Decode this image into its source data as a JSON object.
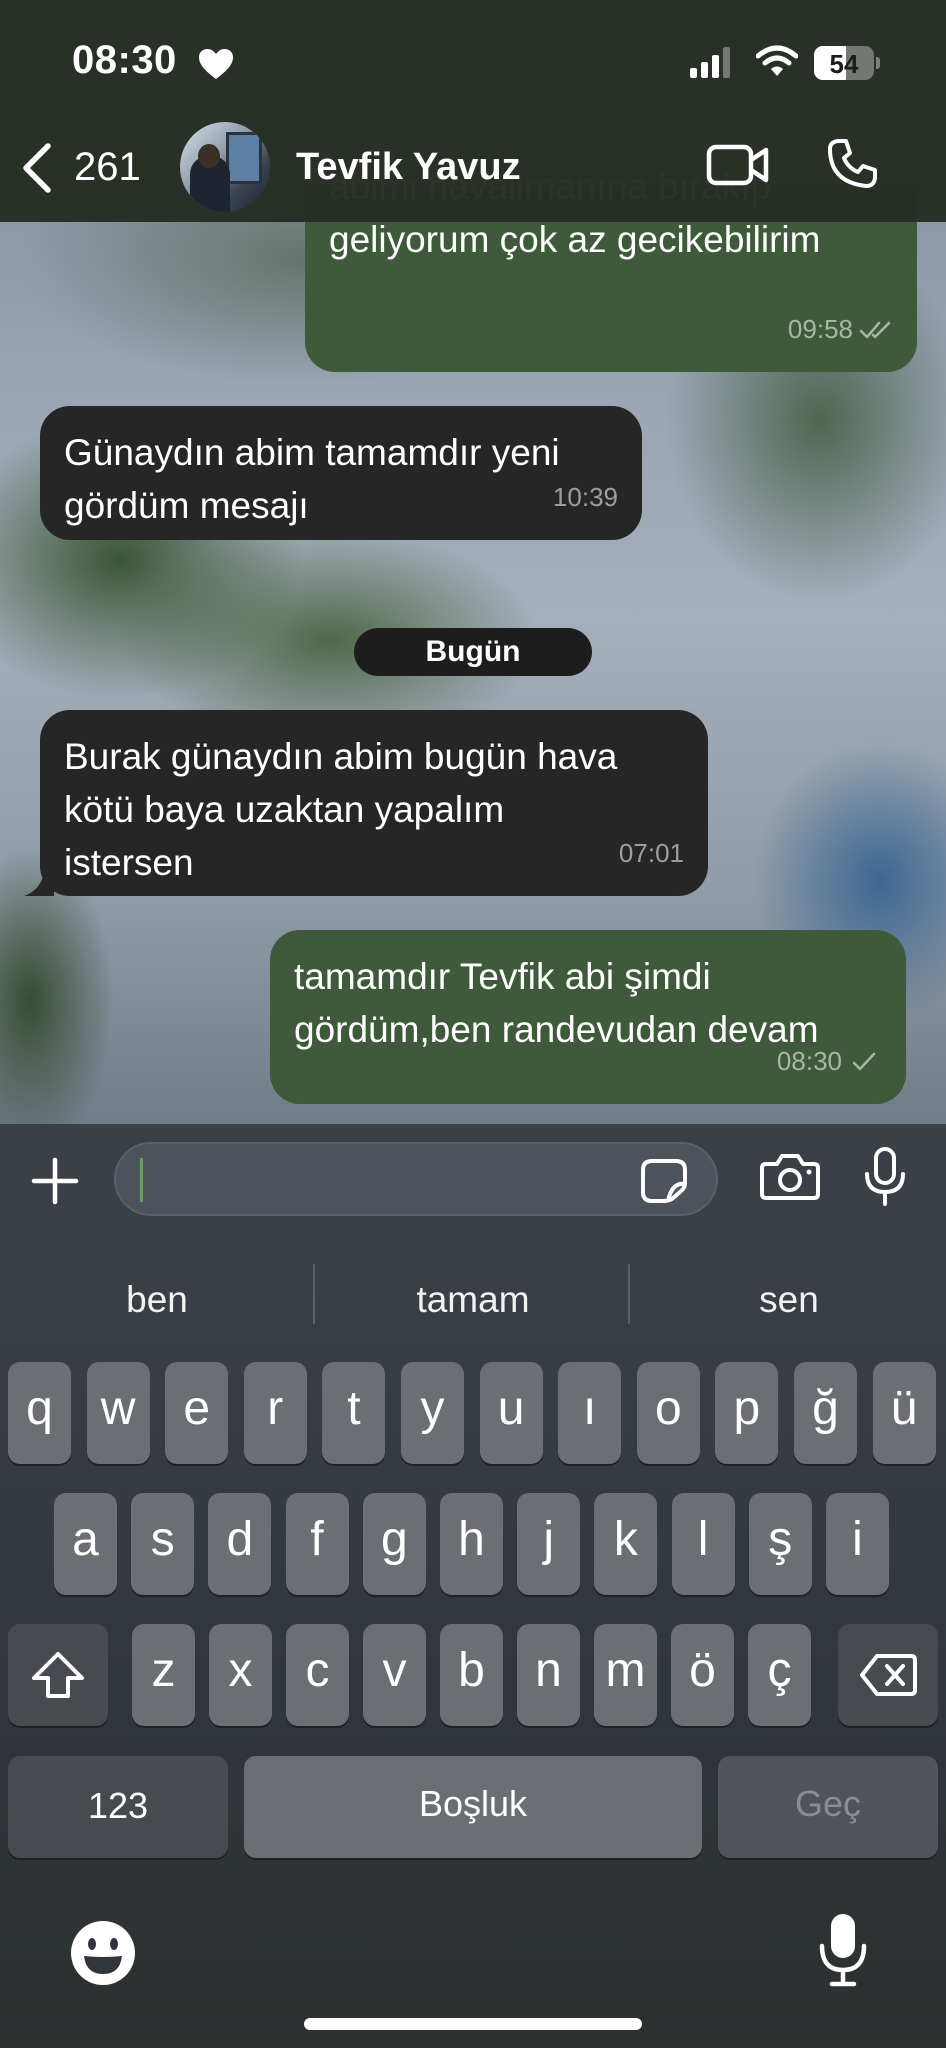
{
  "status_bar": {
    "time": "08:30",
    "battery_level": "54",
    "battery_fraction": 0.54
  },
  "header": {
    "back_count": "261",
    "contact_name": "Tevfik Yavuz"
  },
  "messages": [
    {
      "direction": "outgoing",
      "text": "abimi havalimanına bırakıp\ngeliyorum çok az gecikebilirim",
      "time": "09:58",
      "status": "read"
    },
    {
      "direction": "incoming",
      "text": "Günaydın abim tamamdır yeni\ngördüm mesajı",
      "time": "10:39"
    },
    {
      "direction": "incoming",
      "text": "Burak günaydın abim bugün hava\nkötü baya uzaktan yapalım\nistersen",
      "time": "07:01"
    },
    {
      "direction": "outgoing",
      "text": "tamamdır Tevfik abi şimdi\ngördüm,ben randevudan devam",
      "time": "08:30",
      "status": "sent"
    }
  ],
  "date_separator": "Bugün",
  "composer": {
    "value": "",
    "placeholder": ""
  },
  "keyboard": {
    "suggestions": [
      "ben",
      "tamam",
      "sen"
    ],
    "row1": [
      "q",
      "w",
      "e",
      "r",
      "t",
      "y",
      "u",
      "ı",
      "o",
      "p",
      "ğ",
      "ü"
    ],
    "row2": [
      "a",
      "s",
      "d",
      "f",
      "g",
      "h",
      "j",
      "k",
      "l",
      "ş",
      "i"
    ],
    "row3": [
      "z",
      "x",
      "c",
      "v",
      "b",
      "n",
      "m",
      "ö",
      "ç"
    ],
    "numbers_label": "123",
    "space_label": "Boşluk",
    "return_label": "Geç"
  },
  "colors": {
    "incoming_bubble": "#262626",
    "outgoing_bubble": "#3f5a3a",
    "header_bg": "#262d23"
  }
}
